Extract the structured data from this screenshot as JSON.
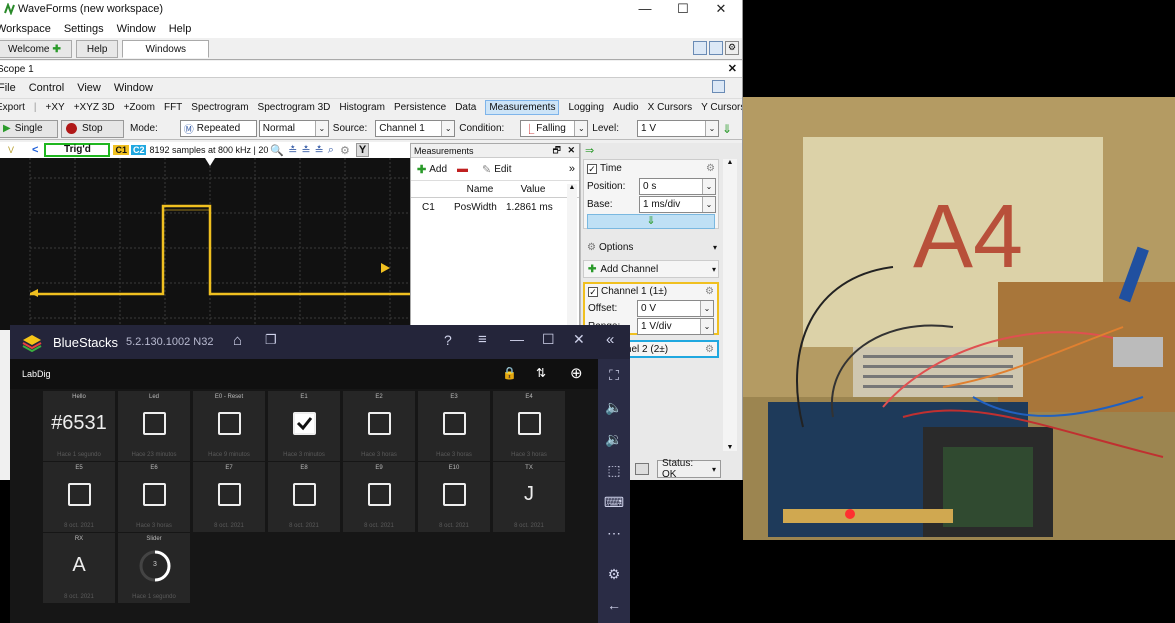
{
  "wf": {
    "title": "WaveForms (new workspace)",
    "win_min": "—",
    "win_max": "☐",
    "win_close": "✕",
    "menu": [
      "Workspace",
      "Settings",
      "Window",
      "Help"
    ],
    "tabs": [
      "Welcome",
      "Help",
      "Windows"
    ],
    "instrument_tab": "Scope 1",
    "scope_menu": [
      "File",
      "Control",
      "View",
      "Window"
    ],
    "toolbar": [
      "Export",
      "+XY",
      "+XYZ 3D",
      "+Zoom",
      "FFT",
      "Spectrogram",
      "Spectrogram 3D",
      "Histogram",
      "Persistence",
      "Data",
      "Measurements",
      "Logging",
      "Audio",
      "X Cursors",
      "Y Cursors",
      "»"
    ],
    "controls": {
      "single": "Single",
      "stop": "Stop",
      "mode_label": "Mode:",
      "mode": "Repeated",
      "mode2": "Normal",
      "source_label": "Source:",
      "source": "Channel 1",
      "condition_label": "Condition:",
      "condition": "Falling",
      "level_label": "Level:",
      "level": "1 V"
    },
    "status_bar": {
      "trig": "Trig'd",
      "c1": "C1",
      "c2": "C2",
      "samples": "8192 samples at 800 kHz | 20"
    },
    "measurements": {
      "title": "Measurements",
      "add": "Add",
      "edit": "Edit",
      "headers": [
        "Name",
        "Value"
      ],
      "rows": [
        {
          "ch": "C1",
          "name": "PosWidth",
          "value": "1.2861 ms"
        }
      ]
    },
    "right": {
      "time_label": "Time",
      "position_label": "Position:",
      "position": "0 s",
      "base_label": "Base:",
      "base": "1 ms/div",
      "options": "Options",
      "add_channel": "Add Channel",
      "ch1": "Channel 1 (1±)",
      "offset_label": "Offset:",
      "offset": "0 V",
      "range_label": "Range:",
      "range": "1 V/div",
      "ch2": "Channel 2 (2±)",
      "status": "Status: OK"
    },
    "colors": {
      "ch1": "#f0c020",
      "ch2": "#20a8e0",
      "trig": "#1fb61f"
    }
  },
  "bs": {
    "title": "BlueStacks",
    "version": "5.2.130.1002 N32",
    "app_title": "LabDig",
    "tiles": [
      {
        "label": "Hello",
        "type": "text",
        "value": "#6531",
        "sub": "Hace 1 segundo"
      },
      {
        "label": "Led",
        "type": "check",
        "value": false,
        "sub": "Hace 23 minutos"
      },
      {
        "label": "E0 - Reset",
        "type": "check",
        "value": false,
        "sub": "Hace 9 minutos"
      },
      {
        "label": "E1",
        "type": "check",
        "value": true,
        "sub": "Hace 3 minutos"
      },
      {
        "label": "E2",
        "type": "check",
        "value": false,
        "sub": "Hace 3 horas"
      },
      {
        "label": "E3",
        "type": "check",
        "value": false,
        "sub": "Hace 3 horas"
      },
      {
        "label": "E4",
        "type": "check",
        "value": false,
        "sub": "Hace 3 horas"
      },
      {
        "label": "E5",
        "type": "check",
        "value": false,
        "sub": "8 oct. 2021"
      },
      {
        "label": "E6",
        "type": "check",
        "value": false,
        "sub": "Hace 3 horas"
      },
      {
        "label": "E7",
        "type": "check",
        "value": false,
        "sub": "8 oct. 2021"
      },
      {
        "label": "E8",
        "type": "check",
        "value": false,
        "sub": "8 oct. 2021"
      },
      {
        "label": "E9",
        "type": "check",
        "value": false,
        "sub": "8 oct. 2021"
      },
      {
        "label": "E10",
        "type": "check",
        "value": false,
        "sub": "8 oct. 2021"
      },
      {
        "label": "TX",
        "type": "text",
        "value": "J",
        "sub": "8 oct. 2021"
      },
      {
        "label": "RX",
        "type": "text",
        "value": "A",
        "sub": "8 oct. 2021"
      },
      {
        "label": "Slider",
        "type": "dial",
        "value": "3",
        "sub": "Hace 1 segundo"
      }
    ],
    "accent": "#4a8cf7"
  },
  "photo": {
    "paper_text": "A4"
  }
}
